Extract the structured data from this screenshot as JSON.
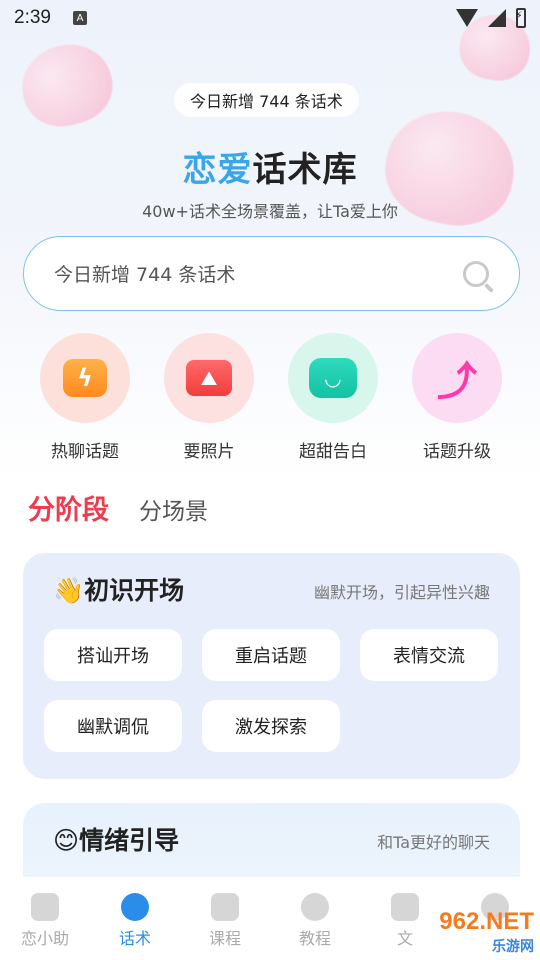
{
  "status_bar": {
    "time": "2:39",
    "notification_letter": "A"
  },
  "header": {
    "new_count_pill": "今日新增 744 条话术",
    "title_accent": "恋爱",
    "title_rest": "话术库",
    "subtitle": "40w+话术全场景覆盖，让Ta爱上你"
  },
  "search": {
    "placeholder": "今日新增 744 条话术",
    "icon": "search-icon"
  },
  "features": [
    {
      "label": "热聊话题",
      "icon": "bolt-icon",
      "bg": "#fde0da"
    },
    {
      "label": "要照片",
      "icon": "photo-icon",
      "bg": "#fde0e0"
    },
    {
      "label": "超甜告白",
      "icon": "chat-smile-icon",
      "bg": "#d8f6ec"
    },
    {
      "label": "话题升级",
      "icon": "arrow-up-icon",
      "bg": "#fbdcf3"
    }
  ],
  "tabs": {
    "active": "分阶段",
    "other": "分场景"
  },
  "card1": {
    "emoji": "👋",
    "title": "初识开场",
    "desc": "幽默开场，引起异性兴趣",
    "chips": [
      "搭讪开场",
      "重启话题",
      "表情交流",
      "幽默调侃",
      "激发探索"
    ]
  },
  "card2": {
    "emoji": "😊",
    "title": "情绪引导",
    "desc": "和Ta更好的聊天"
  },
  "tabbar": [
    {
      "label": "恋小助",
      "icon": "home-icon",
      "active": false
    },
    {
      "label": "话术",
      "icon": "message-icon",
      "active": true
    },
    {
      "label": "课程",
      "icon": "video-icon",
      "active": false
    },
    {
      "label": "教程",
      "icon": "compass-icon",
      "active": false
    },
    {
      "label": "文",
      "icon": "document-icon",
      "active": false
    },
    {
      "label": "",
      "icon": "profile-icon",
      "active": false
    }
  ],
  "watermark": {
    "main": "962.NET",
    "sub": "乐游网"
  }
}
